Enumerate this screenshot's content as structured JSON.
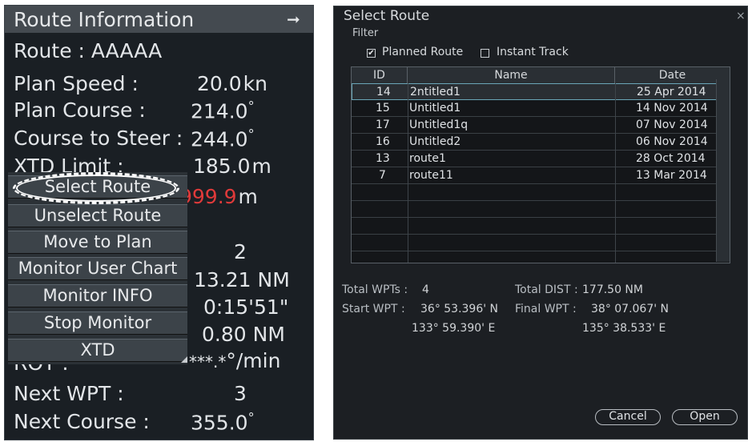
{
  "route_info": {
    "title": "Route Information",
    "arrow": "➞",
    "route_line": "Route : AAAAA",
    "plan_speed": {
      "label": "Plan Speed :",
      "value": "20.0",
      "unit": "kn"
    },
    "plan_course": {
      "label": "Plan Course :",
      "value": "214.0",
      "unit": "°"
    },
    "course_to_steer": {
      "label": "Course to Steer :",
      "value": "244.0",
      "unit": "°"
    },
    "xtd_limit": {
      "label": "XTD Limit :",
      "value": "185.0",
      "unit": "m"
    },
    "xtd_value": {
      "value": "999.9",
      "unit": "m"
    },
    "wpt_count": "2",
    "distance": {
      "value": "13.21",
      "unit": "NM"
    },
    "time": "0:15'51\"",
    "distance2": {
      "value": "0.80",
      "unit": "NM"
    },
    "rot": {
      "label": "ROT :",
      "value": "***.*",
      "unit": "°/min"
    },
    "next_wpt": {
      "label": "Next WPT :",
      "value": "3"
    },
    "next_course": {
      "label": "Next Course :",
      "value": "355.0",
      "unit": "°"
    }
  },
  "context_menu": {
    "items": [
      "Select Route",
      "Unselect Route",
      "Move to Plan",
      "Monitor User Chart",
      "Monitor INFO",
      "Stop Monitor",
      "XTD"
    ]
  },
  "select_route": {
    "title": "Select Route",
    "close": "×",
    "filter_label": "Filter",
    "filters": [
      {
        "label": "Planned Route",
        "checked": true,
        "mark": "✔"
      },
      {
        "label": "Instant Track",
        "checked": false,
        "mark": ""
      }
    ],
    "columns": [
      "ID",
      "Name",
      "Date"
    ],
    "rows": [
      {
        "id": "14",
        "name": "2ntitled1",
        "date": "25 Apr 2014"
      },
      {
        "id": "15",
        "name": "Untitled1",
        "date": "14 Nov 2014"
      },
      {
        "id": "17",
        "name": "Untitled1q",
        "date": "07 Nov 2014"
      },
      {
        "id": "16",
        "name": "Untitled2",
        "date": "06 Nov 2014"
      },
      {
        "id": "13",
        "name": "route1",
        "date": "28 Oct 2014"
      },
      {
        "id": "7",
        "name": "route11",
        "date": "13 Mar 2014"
      }
    ],
    "summary": {
      "total_wpts_label": "Total WPTs :",
      "total_wpts": "4",
      "total_dist_label": "Total DIST :",
      "total_dist": "177.50 NM",
      "start_wpt_label": "Start WPT :",
      "start_lat": "36° 53.396' N",
      "start_lon": "133° 59.390' E",
      "final_wpt_label": "Final WPT :",
      "final_lat": "38° 07.067' N",
      "final_lon": "135° 38.533' E"
    },
    "buttons": {
      "cancel": "Cancel",
      "open": "Open"
    }
  }
}
